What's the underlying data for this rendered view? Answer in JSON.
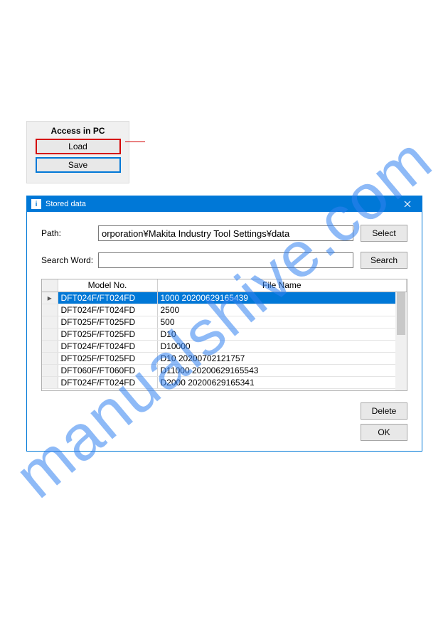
{
  "watermark": "manualshive.com",
  "panel": {
    "title": "Access in PC",
    "load_label": "Load",
    "save_label": "Save"
  },
  "dialog": {
    "title": "Stored data",
    "path_label": "Path:",
    "path_value": "orporation¥Makita Industry Tool Settings¥data",
    "select_label": "Select",
    "search_label": "Search Word:",
    "search_value": "",
    "search_btn": "Search",
    "delete_btn": "Delete",
    "ok_btn": "OK",
    "columns": {
      "model": "Model No.",
      "file": "File Name"
    },
    "rows": [
      {
        "model": "DFT024F/FT024FD",
        "file": "1000 20200629165439",
        "selected": true
      },
      {
        "model": "DFT024F/FT024FD",
        "file": "2500"
      },
      {
        "model": "DFT025F/FT025FD",
        "file": "500"
      },
      {
        "model": "DFT025F/FT025FD",
        "file": "D10"
      },
      {
        "model": "DFT024F/FT024FD",
        "file": "D10000"
      },
      {
        "model": "DFT025F/FT025FD",
        "file": "D10 20200702121757"
      },
      {
        "model": "DFT060F/FT060FD",
        "file": "D11000 20200629165543"
      },
      {
        "model": "DFT024F/FT024FD",
        "file": "D2000 20200629165341"
      }
    ]
  }
}
